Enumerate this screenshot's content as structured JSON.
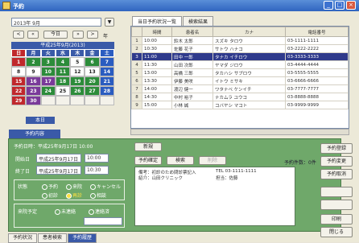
{
  "window": {
    "title": "予約"
  },
  "top_input": {
    "value": "2013年 9月"
  },
  "nav": {
    "prev": "<",
    "month": "今日",
    "next": ">",
    "year": "年"
  },
  "calendar": {
    "header": "平成25年9月(2013)",
    "dow": [
      "日",
      "月",
      "火",
      "水",
      "木",
      "金",
      "土"
    ],
    "rows": [
      [
        "1",
        "2",
        "3",
        "4",
        "5",
        "6",
        "7"
      ],
      [
        "8",
        "9",
        "10",
        "11",
        "12",
        "13",
        "14"
      ],
      [
        "15",
        "16",
        "17",
        "18",
        "19",
        "20",
        "21"
      ],
      [
        "22",
        "23",
        "24",
        "25",
        "26",
        "27",
        "28"
      ],
      [
        "29",
        "30",
        "",
        "",
        "",
        "",
        ""
      ]
    ],
    "footer": "本日"
  },
  "tabs": {
    "list_tab": "当日予約状況一覧",
    "other_tab": "検索結果"
  },
  "grid": {
    "headers": [
      "",
      "時間",
      "患者名",
      "カナ",
      "電話番号"
    ],
    "rows": [
      [
        "1",
        "10:00",
        "鈴木 太郎",
        "スズキ タロウ",
        "03-1111-1111"
      ],
      [
        "2",
        "10:30",
        "佐藤 花子",
        "サトウ ハナコ",
        "03-2222-2222"
      ],
      [
        "3",
        "11:00",
        "田中 一郎",
        "タナカ イチロウ",
        "03-3333-3333"
      ],
      [
        "4",
        "11:30",
        "山田 次郎",
        "ヤマダ ジロウ",
        "03-4444-4444"
      ],
      [
        "5",
        "13:00",
        "高橋 三郎",
        "タカハシ サブロウ",
        "03-5555-5555"
      ],
      [
        "6",
        "13:30",
        "伊藤 美咲",
        "イトウ ミサキ",
        "03-6666-6666"
      ],
      [
        "7",
        "14:00",
        "渡辺 健一",
        "ワタナベ ケンイチ",
        "03-7777-7777"
      ],
      [
        "8",
        "14:30",
        "中村 裕子",
        "ナカムラ ユウコ",
        "03-8888-8888"
      ],
      [
        "9",
        "15:00",
        "小林 誠",
        "コバヤシ マコト",
        "03-9999-9999"
      ]
    ],
    "selected_row": 2
  },
  "form": {
    "section_header": "予約内容",
    "subtitle": "予約日時：平成25年9月17日 10:00",
    "start_label": "開始日",
    "start_date": "平成25年9月17日",
    "start_time": "10:00",
    "end_label": "終了日",
    "end_date": "平成25年9月17日",
    "end_time": "10:30",
    "type_label": "状態",
    "type_options": [
      "予約",
      "来院",
      "キャンセル"
    ],
    "type_options2": [
      "初診",
      "再診",
      "相談"
    ],
    "reminder_label": "来院予定",
    "reminder_options": [
      "未連絡",
      "連絡済"
    ],
    "dropdown_value": ""
  },
  "actions": {
    "new": "新規",
    "reserve": "予約確定",
    "search": "検索",
    "delete": "削除",
    "count_label": "予約件数：0件"
  },
  "memo": {
    "lines": [
      "備考：初診のため問診票記入",
      "紹介：山田クリニック"
    ],
    "right_lines": [
      "TEL 03-1111-1111",
      "担当：佐藤"
    ]
  },
  "right_buttons": [
    "予約登録",
    "予約変更",
    "予約取消",
    "",
    "",
    "印刷",
    "閉じる"
  ],
  "status_tabs": [
    "予約状況",
    "患者検索",
    "予約履歴"
  ]
}
